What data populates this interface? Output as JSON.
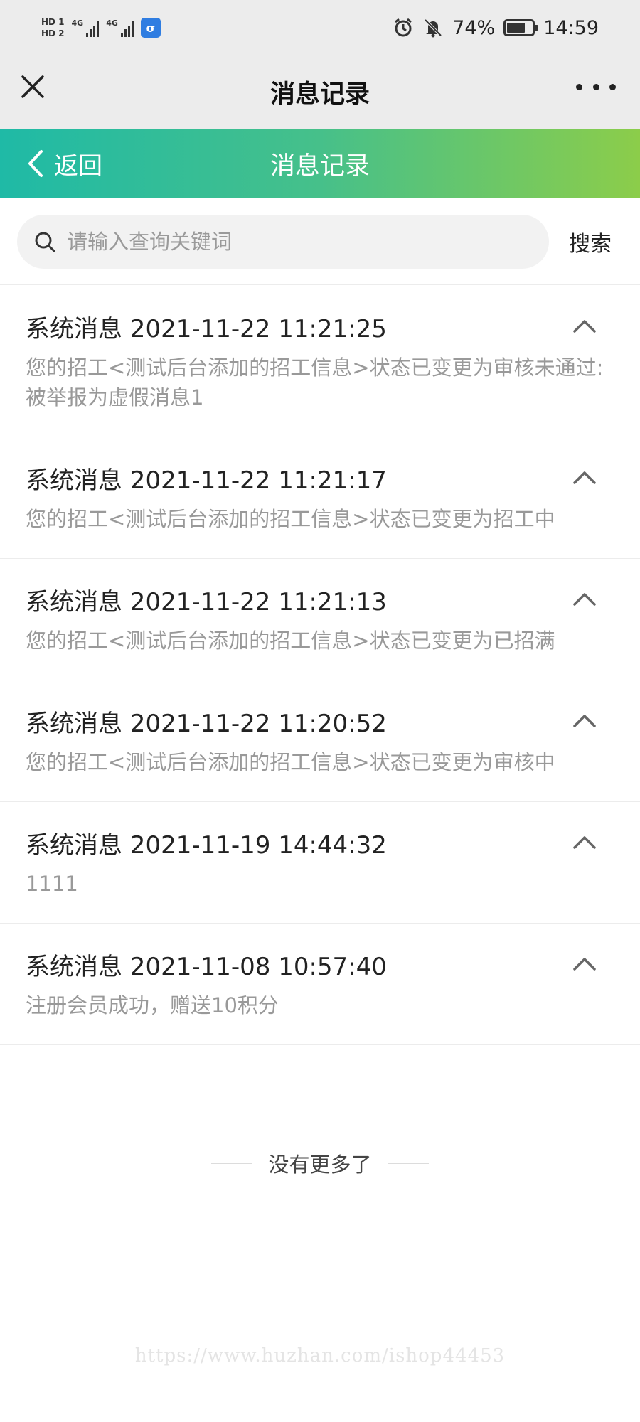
{
  "status_bar": {
    "hd1": "HD 1",
    "hd2": "HD 2",
    "net1": "4G",
    "net2": "4G",
    "battery": "74%",
    "time": "14:59",
    "app_badge": "σ"
  },
  "header": {
    "title": "消息记录"
  },
  "nav": {
    "back_label": "返回",
    "title": "消息记录"
  },
  "search": {
    "placeholder": "请输入查询关键词",
    "button": "搜索"
  },
  "messages": [
    {
      "title": "系统消息 2021-11-22 11:21:25",
      "body": "您的招工<测试后台添加的招工信息>状态已变更为审核未通过:被举报为虚假消息1"
    },
    {
      "title": "系统消息 2021-11-22 11:21:17",
      "body": "您的招工<测试后台添加的招工信息>状态已变更为招工中"
    },
    {
      "title": "系统消息 2021-11-22 11:21:13",
      "body": "您的招工<测试后台添加的招工信息>状态已变更为已招满"
    },
    {
      "title": "系统消息 2021-11-22 11:20:52",
      "body": "您的招工<测试后台添加的招工信息>状态已变更为审核中"
    },
    {
      "title": "系统消息 2021-11-19 14:44:32",
      "body": "1111"
    },
    {
      "title": "系统消息 2021-11-08 10:57:40",
      "body": "注册会员成功，赠送10积分"
    }
  ],
  "footer": {
    "no_more": "没有更多了",
    "watermark": "https://www.huzhan.com/ishop44453"
  },
  "colors": {
    "nav_gradient_start": "#1fbaa6",
    "nav_gradient_end": "#8ccd4a",
    "header_bg": "#ececec"
  }
}
